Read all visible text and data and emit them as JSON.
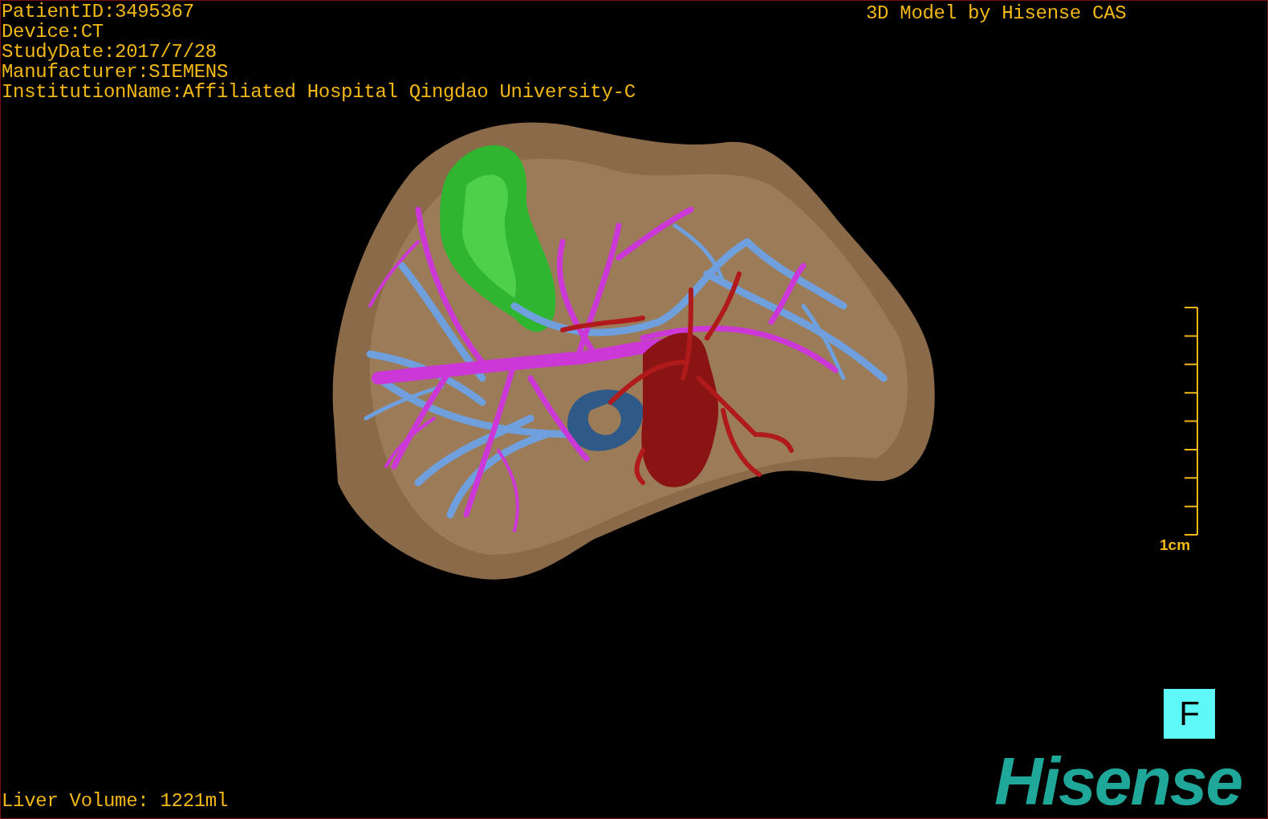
{
  "header_lines": [
    "PatientID:3495367",
    "Device:CT",
    "StudyDate:2017/7/28",
    "Manufacturer:SIEMENS",
    "InstitutionName:Affiliated Hospital Qingdao University-C"
  ],
  "credit": "3D Model by Hisense CAS",
  "scale": {
    "label": "1cm"
  },
  "orientation": {
    "label": "F"
  },
  "liver_volume": "Liver Volume: 1221ml",
  "logo": "Hisense"
}
